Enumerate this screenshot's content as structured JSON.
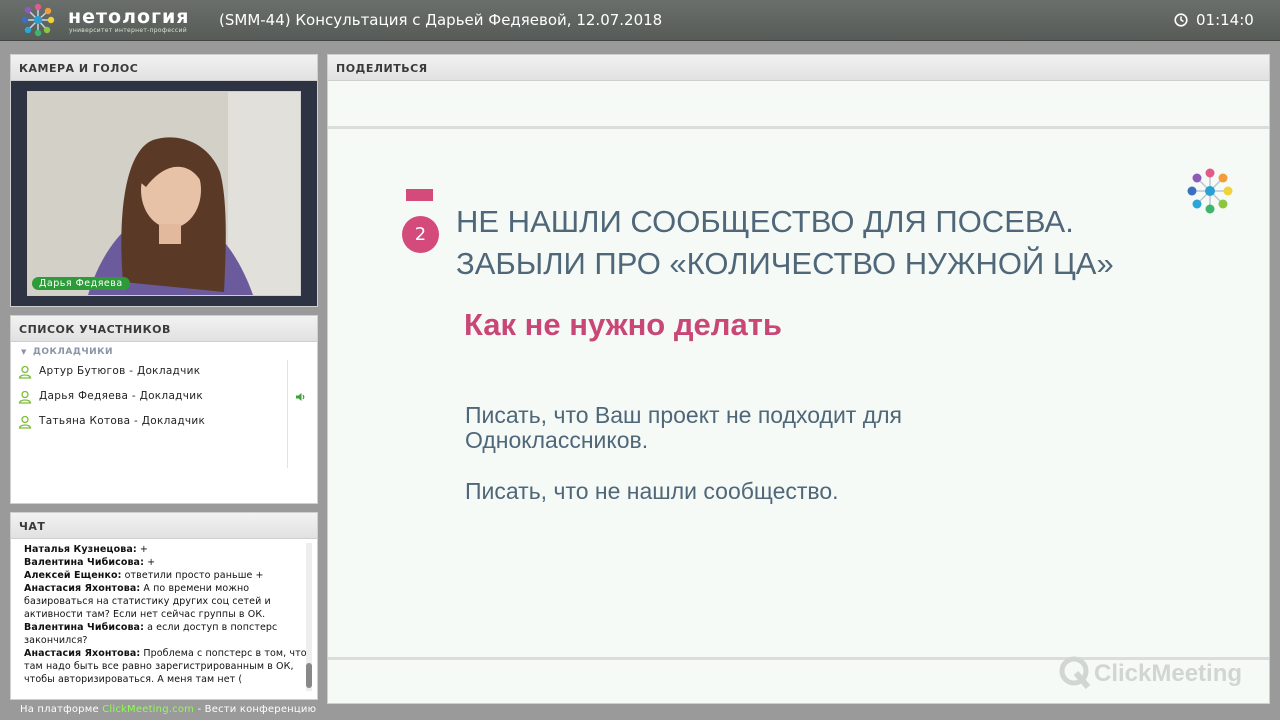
{
  "header": {
    "brand": "нетология",
    "brand_sub": "университет интернет-профессий",
    "title": "(SMM-44) Консультация с Дарьей Федяевой, 12.07.2018",
    "timer": "01:14:0"
  },
  "camera": {
    "header": "КАМЕРА И ГОЛОС",
    "speaker_name": "Дарья Федяева"
  },
  "participants": {
    "header": "СПИСОК УЧАСТНИКОВ",
    "group": "ДОКЛАДЧИКИ",
    "items": [
      {
        "label": "Артур Бутюгов  - Докладчик"
      },
      {
        "label": "Дарья Федяева  - Докладчик"
      },
      {
        "label": "Татьяна Котова  - Докладчик"
      }
    ]
  },
  "chat": {
    "header": "ЧАТ",
    "messages": [
      {
        "author": "Наталья Кузнецова:",
        "text": " +"
      },
      {
        "author": "Валентина Чибисова:",
        "text": " +"
      },
      {
        "author": "Алексей Ещенко:",
        "text": " ответили просто раньше +"
      },
      {
        "author": "Анастасия Яхонтова:",
        "text": " А по времени можно базироваться на статистику других соц сетей и активности там? Если нет сейчас группы в ОК."
      },
      {
        "author": "Валентина Чибисова:",
        "text": " а если доступ в попстерс закончился?"
      },
      {
        "author": "Анастасия Яхонтова:",
        "text": " Проблема с попстерс в том, что там надо быть все равно зарегистрированным в ОК, чтобы авторизироваться. А меня там нет ("
      }
    ]
  },
  "footer": {
    "prefix": "На платформе ",
    "link": "ClickMeeting.com",
    "suffix": " - Вести конференцию"
  },
  "share": {
    "header": "ПОДЕЛИТЬСЯ",
    "slide": {
      "number": "2",
      "title_line1": "НЕ НАШЛИ СООБЩЕСТВО ДЛЯ ПОСЕВА.",
      "title_line2": "ЗАБЫЛИ ПРО «КОЛИЧЕСТВО НУЖНОЙ ЦА»",
      "subtitle": "Как не нужно делать",
      "para1": "Писать, что Ваш проект не подходит для Одноклассников.",
      "para2": "Писать, что не нашли сообщество."
    },
    "watermark": "ClickMeeting"
  },
  "colors": {
    "accent_pink": "#d34a7b",
    "slide_text": "#4f6779",
    "online_green": "#2e9b3a"
  }
}
